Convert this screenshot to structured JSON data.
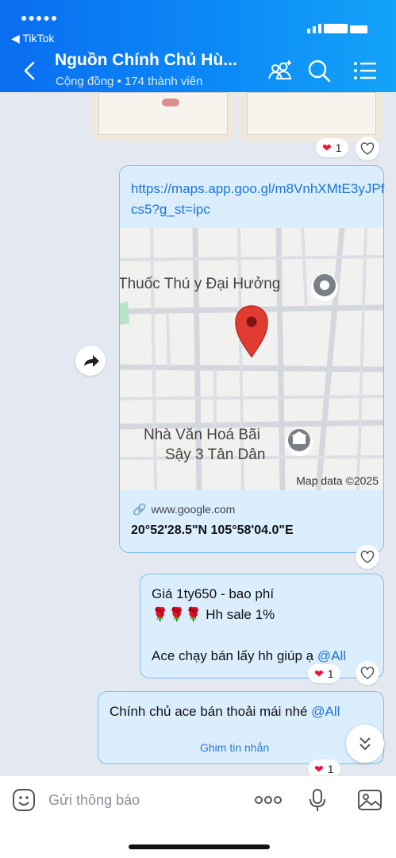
{
  "status": {
    "back_app": "◀ TikTok"
  },
  "header": {
    "title": "Nguồn Chính Chủ Hù...",
    "subtitle": "Cộng đồng • 174 thành viên"
  },
  "messages": {
    "prev_image_reaction": "1",
    "location": {
      "link": "https://maps.app.goo.gl/m8VnhXMtE3yJPfcs5?g_st=ipc",
      "map_place_1": "Thuốc Thú y Đại Hưởng",
      "map_place_2_line1": "Nhà Văn Hoá Bãi",
      "map_place_2_line2": "Sậy 3 Tân Dân",
      "map_credit": "Map data ©2025",
      "site": "www.google.com",
      "coords": "20°52'28.5\"N 105°58'04.0\"E"
    },
    "price_msg": {
      "line1": "Giá 1ty650 - bao phí",
      "line2_emoji": "🌹🌹🌹",
      "line2_text": "Hh sale 1%",
      "line3": "Ace chạy bán lấy hh giúp ạ",
      "mention": "@All",
      "reaction": "1"
    },
    "last_msg": {
      "text": "Chính chủ ace bán thoải mái nhé",
      "mention": "@All",
      "pin_label": "Ghim tin nhắn",
      "reaction": "1"
    }
  },
  "input": {
    "placeholder": "Gửi thông báo"
  },
  "colors": {
    "header_start": "#0a6df0",
    "header_end": "#14a3f8",
    "bubble_bg": "#dbeefe",
    "bubble_border": "#7fbdf0",
    "link": "#1c74d6",
    "heart": "#e5193b",
    "map_pin": "#e23b32"
  }
}
